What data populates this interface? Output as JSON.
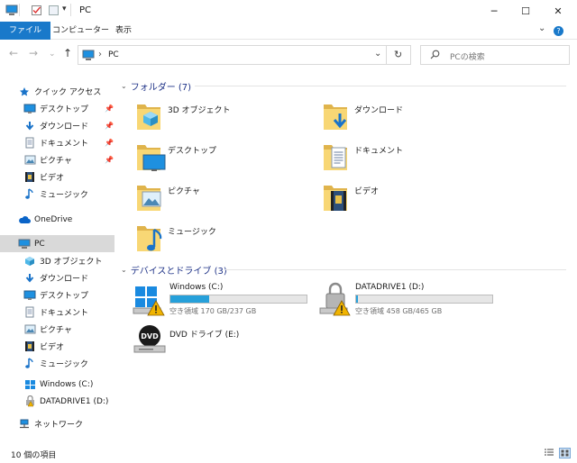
{
  "window": {
    "title": "PC",
    "minimize_glyph": "─",
    "maximize_glyph": "☐",
    "close_glyph": "✕",
    "quick_access_dropdown": "▾"
  },
  "ribbon": {
    "tabs": [
      {
        "label": "ファイル"
      },
      {
        "label": "コンピューター"
      },
      {
        "label": "表示"
      }
    ],
    "expand_glyph": "⌄",
    "help_glyph": "?"
  },
  "navigation": {
    "back_glyph": "←",
    "forward_glyph": "→",
    "recent_glyph": "⌄",
    "up_glyph": "↑",
    "address_separator": "›",
    "address_path": "PC",
    "address_dropdown_glyph": "⌄",
    "refresh_glyph": "↻",
    "search_placeholder": "PCの検索"
  },
  "sidebar": {
    "items": [
      {
        "label": "クイック アクセス",
        "icon": "star-icon"
      },
      {
        "label": "デスクトップ",
        "icon": "desktop-icon",
        "pinned": true
      },
      {
        "label": "ダウンロード",
        "icon": "download-icon",
        "pinned": true
      },
      {
        "label": "ドキュメント",
        "icon": "document-icon",
        "pinned": true
      },
      {
        "label": "ピクチャ",
        "icon": "picture-icon",
        "pinned": true
      },
      {
        "label": "ビデオ",
        "icon": "video-icon"
      },
      {
        "label": "ミュージック",
        "icon": "music-icon"
      },
      {
        "label": "OneDrive",
        "icon": "cloud-icon"
      },
      {
        "label": "PC",
        "icon": "pc-icon",
        "selected": true
      },
      {
        "label": "3D オブジェクト",
        "icon": "cube-icon"
      },
      {
        "label": "ダウンロード",
        "icon": "download-icon"
      },
      {
        "label": "デスクトップ",
        "icon": "desktop-icon"
      },
      {
        "label": "ドキュメント",
        "icon": "document-icon"
      },
      {
        "label": "ピクチャ",
        "icon": "picture-icon"
      },
      {
        "label": "ビデオ",
        "icon": "video-icon"
      },
      {
        "label": "ミュージック",
        "icon": "music-icon"
      },
      {
        "label": "Windows (C:)",
        "icon": "drive-icon"
      },
      {
        "label": "DATADRIVE1 (D:)",
        "icon": "drive-warning-icon"
      },
      {
        "label": "ネットワーク",
        "icon": "network-icon"
      }
    ],
    "pin_glyph": "📌"
  },
  "content": {
    "folders_header": "フォルダー (7)",
    "devices_header": "デバイスとドライブ (3)",
    "collapse_glyph": "⌄",
    "folders": [
      {
        "label": "3D オブジェクト",
        "icon": "cube-folder-icon"
      },
      {
        "label": "ダウンロード",
        "icon": "download-folder-icon"
      },
      {
        "label": "デスクトップ",
        "icon": "desktop-folder-icon"
      },
      {
        "label": "ドキュメント",
        "icon": "document-folder-icon"
      },
      {
        "label": "ピクチャ",
        "icon": "picture-folder-icon"
      },
      {
        "label": "ビデオ",
        "icon": "video-folder-icon"
      },
      {
        "label": "ミュージック",
        "icon": "music-folder-icon"
      }
    ],
    "drives": [
      {
        "name": "Windows (C:)",
        "free_text": "空き領域 170 GB/237 GB",
        "used_fraction": 0.283,
        "icon": "windows-drive-icon"
      },
      {
        "name": "DATADRIVE1 (D:)",
        "free_text": "空き領域 458 GB/465 GB",
        "used_fraction": 0.015,
        "icon": "data-drive-icon"
      },
      {
        "name": "DVD ドライブ (E:)",
        "icon": "dvd-drive-icon",
        "dvd_label": "DVD"
      }
    ]
  },
  "status_bar": {
    "item_count": "10 個の項目"
  },
  "colors": {
    "accent": "#1979ca",
    "folder_yellow": "#f8d775",
    "folder_dark": "#e0b44c",
    "bar_fill": "#26a0da",
    "selected": "#d9d9d9"
  }
}
